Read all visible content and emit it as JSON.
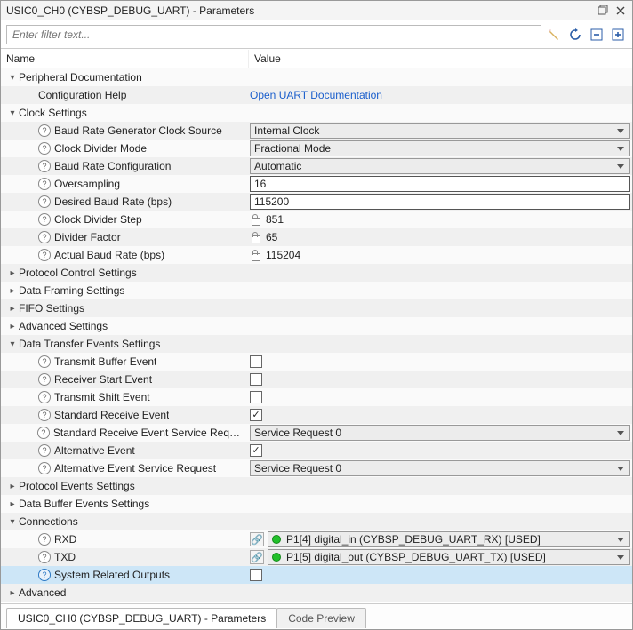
{
  "window": {
    "title": "USIC0_CH0 (CYBSP_DEBUG_UART) - Parameters"
  },
  "filter": {
    "placeholder": "Enter filter text..."
  },
  "columns": {
    "name": "Name",
    "value": "Value"
  },
  "tree": {
    "peripheral_doc": {
      "label": "Peripheral Documentation",
      "config_help": {
        "label": "Configuration Help",
        "link": "Open UART Documentation"
      }
    },
    "clock_settings": {
      "label": "Clock Settings",
      "baud_gen_src": {
        "label": "Baud Rate Generator Clock Source",
        "value": "Internal Clock"
      },
      "clk_div_mode": {
        "label": "Clock Divider Mode",
        "value": "Fractional Mode"
      },
      "baud_rate_cfg": {
        "label": "Baud Rate Configuration",
        "value": "Automatic"
      },
      "oversampling": {
        "label": "Oversampling",
        "value": "16"
      },
      "desired_baud": {
        "label": "Desired Baud Rate (bps)",
        "value": "115200"
      },
      "clk_div_step": {
        "label": "Clock Divider Step",
        "value": "851"
      },
      "div_factor": {
        "label": "Divider Factor",
        "value": "65"
      },
      "actual_baud": {
        "label": "Actual Baud Rate (bps)",
        "value": "115204"
      }
    },
    "protocol_ctrl": {
      "label": "Protocol Control Settings"
    },
    "data_framing": {
      "label": "Data Framing Settings"
    },
    "fifo": {
      "label": "FIFO Settings"
    },
    "advanced_settings": {
      "label": "Advanced Settings"
    },
    "data_transfer": {
      "label": "Data Transfer Events Settings",
      "tx_buf": {
        "label": "Transmit Buffer Event",
        "checked": false
      },
      "rx_start": {
        "label": "Receiver Start Event",
        "checked": false
      },
      "tx_shift": {
        "label": "Transmit Shift Event",
        "checked": false
      },
      "std_rx": {
        "label": "Standard Receive Event",
        "checked": true
      },
      "std_rx_srq": {
        "label": "Standard Receive Event Service Request",
        "value": "Service Request 0"
      },
      "alt_evt": {
        "label": "Alternative Event",
        "checked": true
      },
      "alt_evt_srq": {
        "label": "Alternative Event Service Request",
        "value": "Service Request 0"
      }
    },
    "protocol_events": {
      "label": "Protocol Events Settings"
    },
    "data_buffer_events": {
      "label": "Data Buffer Events Settings"
    },
    "connections": {
      "label": "Connections",
      "rxd": {
        "label": "RXD",
        "value": "P1[4] digital_in (CYBSP_DEBUG_UART_RX) [USED]"
      },
      "txd": {
        "label": "TXD",
        "value": "P1[5] digital_out (CYBSP_DEBUG_UART_TX) [USED]"
      },
      "sys_outputs": {
        "label": "System Related Outputs",
        "checked": false
      }
    },
    "advanced": {
      "label": "Advanced"
    }
  },
  "tabs": {
    "parameters": "USIC0_CH0 (CYBSP_DEBUG_UART) - Parameters",
    "code_preview": "Code Preview"
  }
}
